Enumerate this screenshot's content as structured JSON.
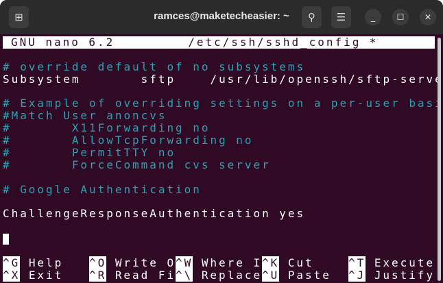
{
  "window": {
    "title": "ramces@maketecheasier: ~"
  },
  "nano": {
    "version": "GNU nano 6.2",
    "filename": "/etc/ssh/sshd_config *"
  },
  "lines": [
    {
      "text": "",
      "type": "plain"
    },
    {
      "text": "# override default of no subsystems",
      "type": "comment"
    },
    {
      "text": "Subsystem       sftp    /usr/lib/openssh/sftp-server",
      "type": "plain"
    },
    {
      "text": "",
      "type": "plain"
    },
    {
      "text": "# Example of overriding settings on a per-user basis",
      "type": "comment"
    },
    {
      "text": "#Match User anoncvs",
      "type": "comment"
    },
    {
      "text": "#       X11Forwarding no",
      "type": "comment"
    },
    {
      "text": "#       AllowTcpForwarding no",
      "type": "comment"
    },
    {
      "text": "#       PermitTTY no",
      "type": "comment"
    },
    {
      "text": "#       ForceCommand cvs server",
      "type": "comment"
    },
    {
      "text": "",
      "type": "plain"
    },
    {
      "text": "# Google Authentication",
      "type": "comment"
    },
    {
      "text": "",
      "type": "plain"
    },
    {
      "text": "ChallengeResponseAuthentication yes",
      "type": "plain"
    },
    {
      "text": "",
      "type": "plain"
    }
  ],
  "shortcuts": [
    [
      {
        "key": "^G",
        "label": "Help"
      },
      {
        "key": "^O",
        "label": "Write Out"
      },
      {
        "key": "^W",
        "label": "Where Is"
      },
      {
        "key": "^K",
        "label": "Cut"
      },
      {
        "key": "^T",
        "label": "Execute"
      }
    ],
    [
      {
        "key": "^X",
        "label": "Exit"
      },
      {
        "key": "^R",
        "label": "Read File"
      },
      {
        "key": "^\\",
        "label": "Replace"
      },
      {
        "key": "^U",
        "label": "Paste"
      },
      {
        "key": "^J",
        "label": "Justify"
      }
    ]
  ]
}
